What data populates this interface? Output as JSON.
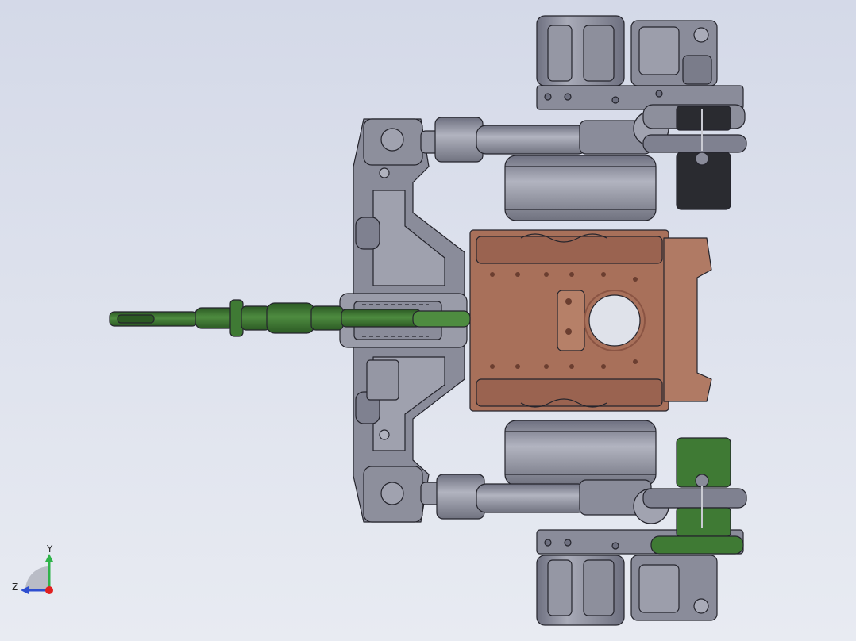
{
  "viewport": {
    "background_top": "#d4d9e8",
    "background_bottom": "#e8ebf2"
  },
  "model": {
    "colors": {
      "steel": "#8a8c9a",
      "steel_light": "#a9abb8",
      "steel_dark": "#6e7080",
      "outline": "#24242c",
      "bronze": "#a8705a",
      "bronze_dark": "#8a5443",
      "green": "#3f7a34",
      "green_dark": "#2c5a24",
      "black_part": "#2a2b30"
    }
  },
  "triad": {
    "y_label": "Y",
    "z_label": "Z",
    "y_color": "#2fb34a",
    "z_color": "#2f4fd0",
    "x_color": "#e02020"
  }
}
